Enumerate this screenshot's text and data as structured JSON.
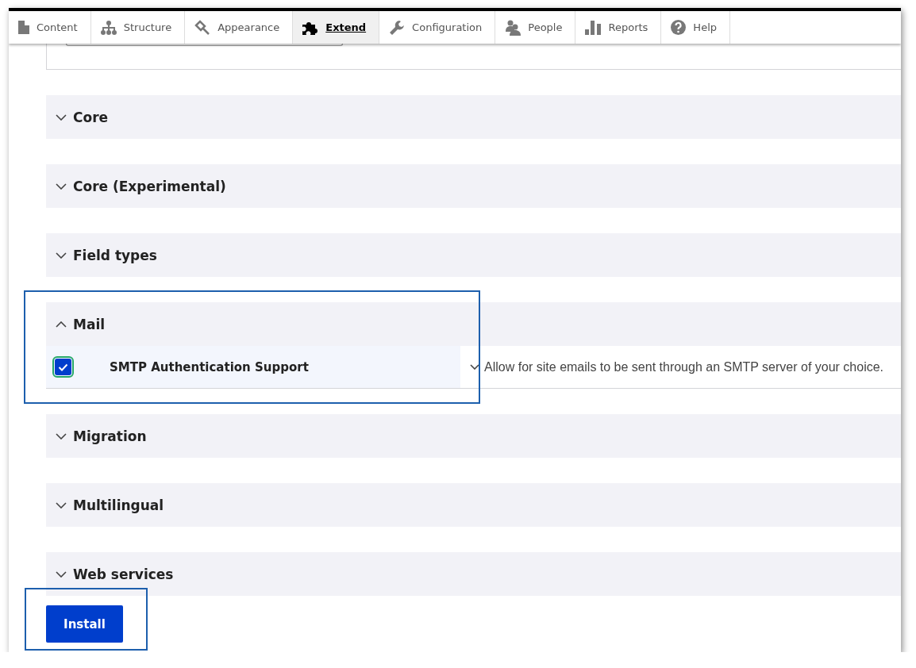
{
  "toolbar": {
    "items": [
      {
        "label": "Content",
        "selected": false
      },
      {
        "label": "Structure",
        "selected": false
      },
      {
        "label": "Appearance",
        "selected": false
      },
      {
        "label": "Extend",
        "selected": true
      },
      {
        "label": "Configuration",
        "selected": false
      },
      {
        "label": "People",
        "selected": false
      },
      {
        "label": "Reports",
        "selected": false
      },
      {
        "label": "Help",
        "selected": false
      }
    ]
  },
  "groups": [
    {
      "title": "Core",
      "expanded": false,
      "highlighted": false
    },
    {
      "title": "Core (Experimental)",
      "expanded": false,
      "highlighted": false
    },
    {
      "title": "Field types",
      "expanded": false,
      "highlighted": false
    },
    {
      "title": "Mail",
      "expanded": true,
      "highlighted": true,
      "modules": [
        {
          "name": "SMTP Authentication Support",
          "checked": true,
          "description": "Allow for site emails to be sent through an SMTP server of your choice."
        }
      ]
    },
    {
      "title": "Migration",
      "expanded": false,
      "highlighted": false
    },
    {
      "title": "Multilingual",
      "expanded": false,
      "highlighted": false
    },
    {
      "title": "Web services",
      "expanded": false,
      "highlighted": false
    }
  ],
  "install_button": {
    "label": "Install",
    "highlighted": true
  }
}
